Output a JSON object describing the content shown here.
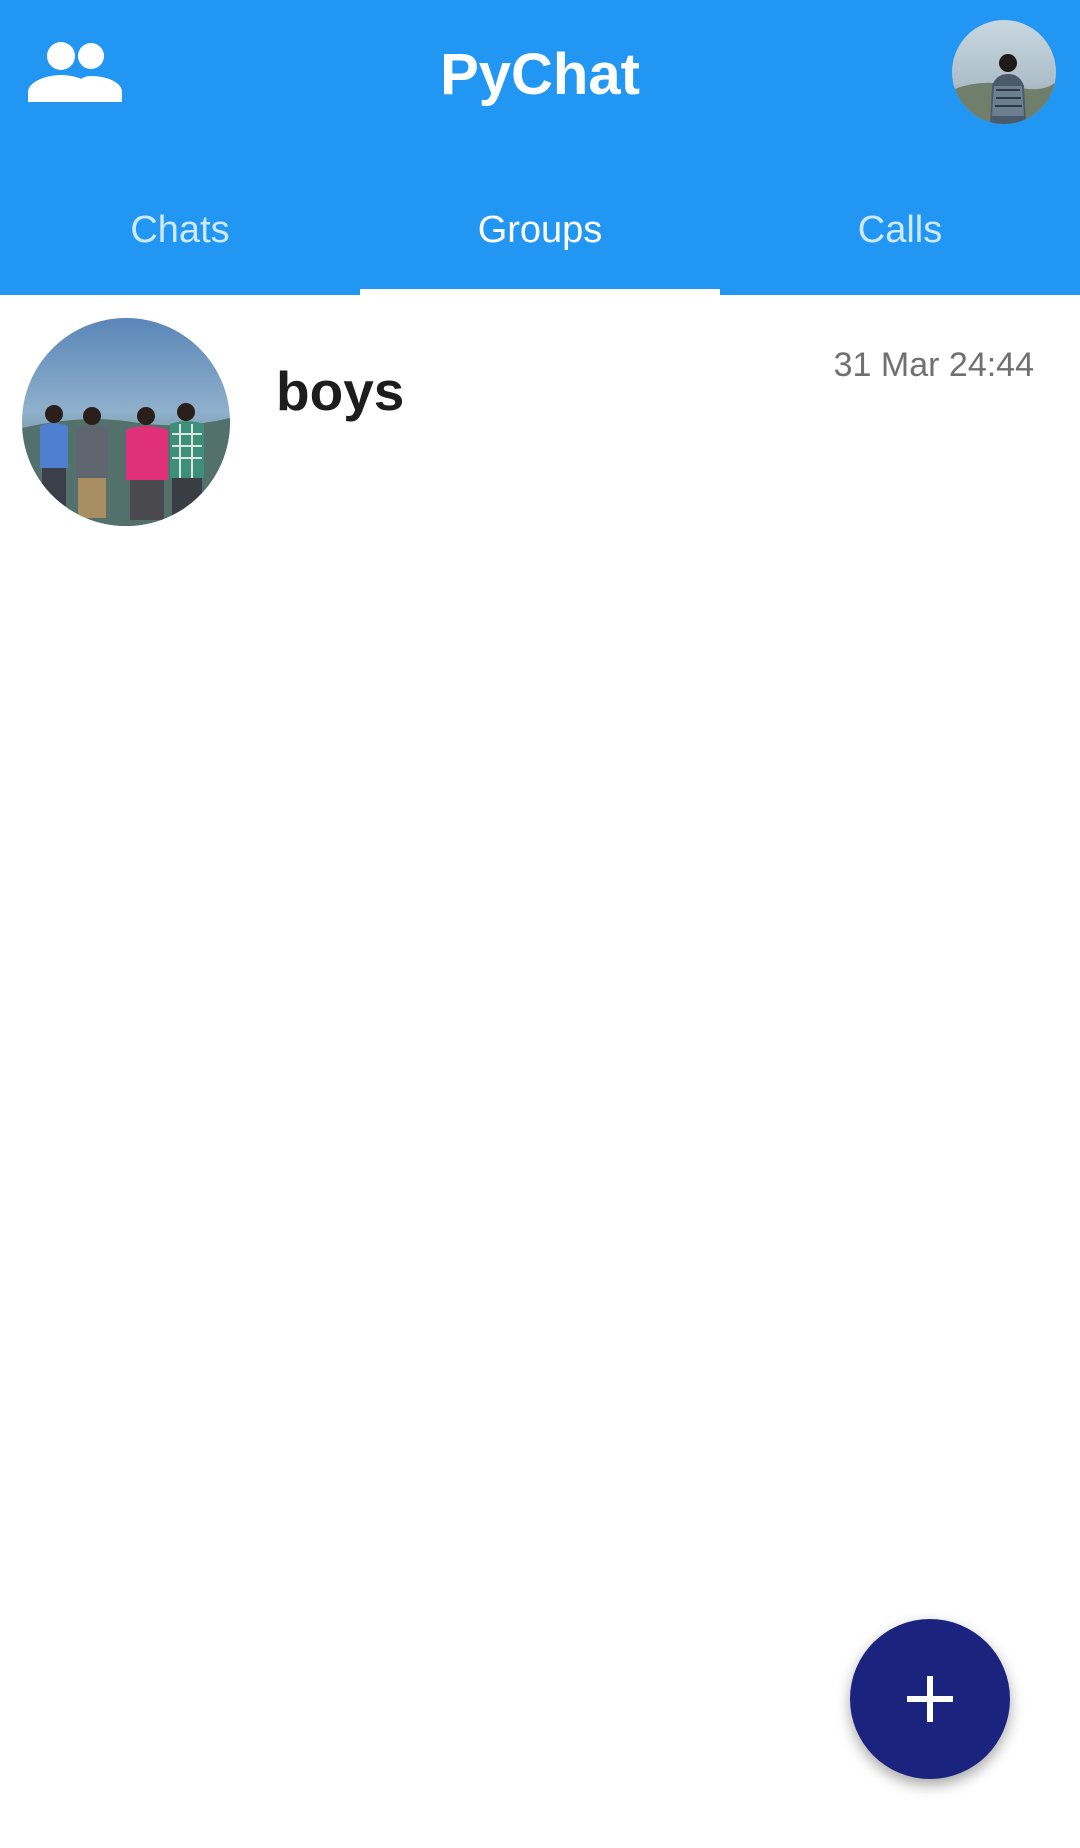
{
  "app": {
    "title": "PyChat",
    "brand_color": "#2196F3",
    "fab_color": "#1a237e"
  },
  "header": {
    "left_icon": "groups-icon",
    "right_icon": "profile-avatar"
  },
  "tabs": [
    {
      "label": "Chats",
      "active": false
    },
    {
      "label": "Groups",
      "active": true
    },
    {
      "label": "Calls",
      "active": false
    }
  ],
  "groups": [
    {
      "name": "boys",
      "timestamp": "31 Mar 24:44",
      "avatar": "group-photo"
    }
  ],
  "fab": {
    "icon": "plus-icon"
  }
}
